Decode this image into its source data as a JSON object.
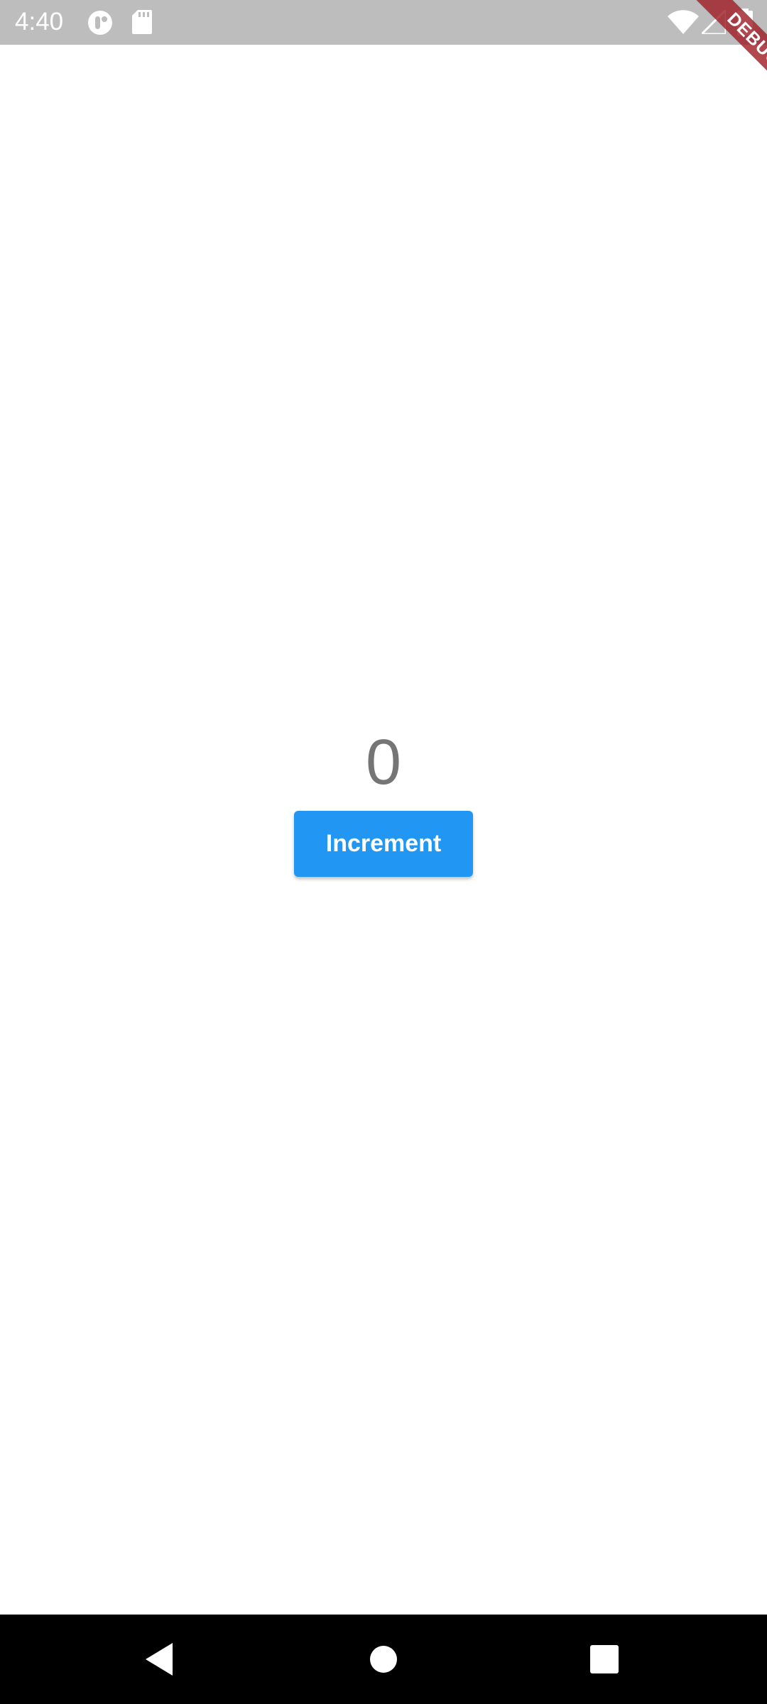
{
  "status_bar": {
    "time": "4:40",
    "icons": [
      "app-notification-icon",
      "sd-card-icon",
      "wifi-icon",
      "cell-signal-icon",
      "battery-icon"
    ]
  },
  "debug_banner": {
    "label": "DEBUG",
    "color": "#a01e28"
  },
  "main": {
    "counter_value": "0",
    "increment_label": "Increment",
    "button_color": "#2196f3"
  },
  "nav_bar": {
    "icons": [
      "back-icon",
      "home-icon",
      "recents-icon"
    ]
  }
}
